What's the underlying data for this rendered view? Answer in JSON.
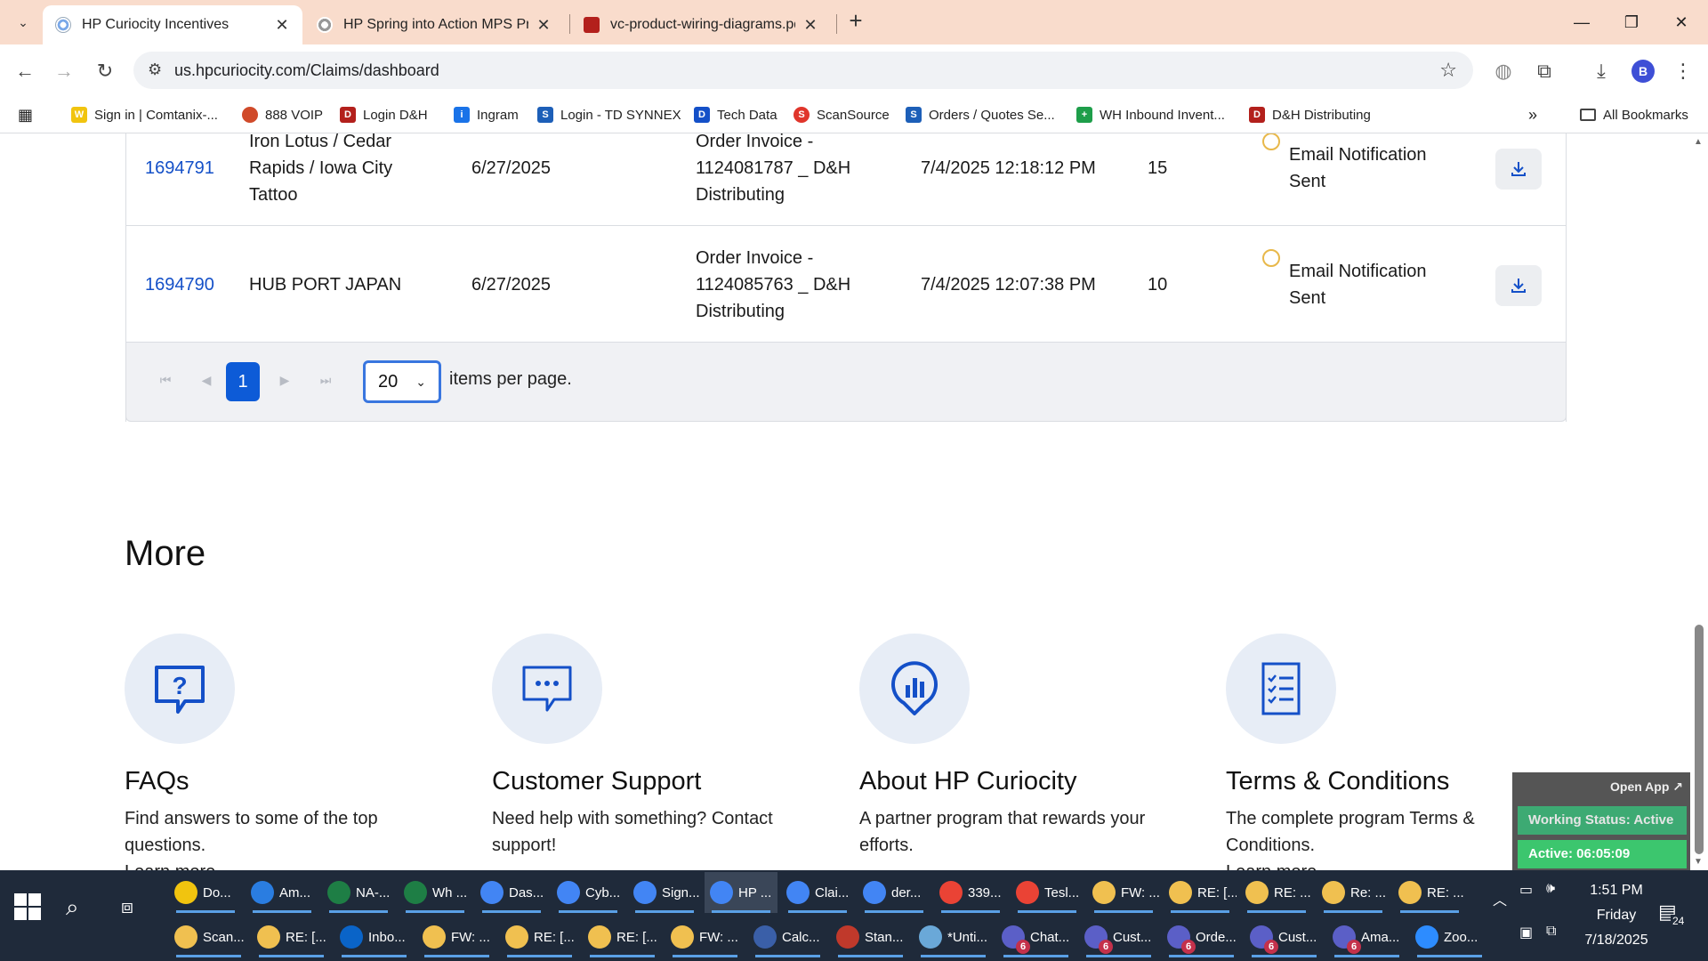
{
  "browser": {
    "tabs": [
      {
        "title": "HP Curiocity Incentives",
        "active": true
      },
      {
        "title": "HP Spring into Action MPS Pro",
        "active": false
      },
      {
        "title": "vc-product-wiring-diagrams.pd",
        "active": false
      }
    ],
    "url": "us.hpcuriocity.com/Claims/dashboard",
    "profile_initial": "B",
    "bookmarks": [
      "Sign in | Comtanix-...",
      "888 VOIP",
      "Login D&H",
      "Ingram",
      "Login - TD SYNNEX",
      "Tech Data",
      "ScanSource",
      "Orders / Quotes Se...",
      "WH Inbound Invent...",
      "D&H Distributing"
    ],
    "all_bookmarks": "All Bookmarks"
  },
  "claims": {
    "rows": [
      {
        "claim_id": "1694791",
        "customer_lines": [
          "Iron Lotus / Cedar",
          "Rapids / Iowa City",
          "Tattoo"
        ],
        "date": "6/27/2025",
        "document_lines": [
          "Order Invoice -",
          "1124081787 _ D&H",
          "Distributing"
        ],
        "submitted": "7/4/2025 12:18:12 PM",
        "quantity": "15",
        "status_lines": [
          "Email Notification",
          "Sent"
        ]
      },
      {
        "claim_id": "1694790",
        "customer_lines": [
          "HUB PORT JAPAN"
        ],
        "date": "6/27/2025",
        "document_lines": [
          "Order Invoice -",
          "1124085763 _ D&H",
          "Distributing"
        ],
        "submitted": "7/4/2025 12:07:38 PM",
        "quantity": "10",
        "status_lines": [
          "Email Notification",
          "Sent"
        ]
      }
    ],
    "pager": {
      "current_page": "1",
      "page_size": "20",
      "label": "items per page."
    }
  },
  "more": {
    "title": "More",
    "cards": [
      {
        "title": "FAQs",
        "desc_lines": [
          "Find answers to some of the top questions."
        ],
        "link": "Learn more",
        "icon": "question-bubble-icon"
      },
      {
        "title": "Customer Support",
        "desc_lines": [
          "Need help with something? Contact",
          "support!"
        ],
        "link": "",
        "icon": "chat-bubble-icon"
      },
      {
        "title": "About HP Curiocity",
        "desc_lines": [
          "A partner program that rewards your",
          "efforts."
        ],
        "link": "",
        "icon": "chart-pin-icon"
      },
      {
        "title": "Terms & Conditions",
        "desc_lines": [
          "The complete program Terms & Conditions."
        ],
        "link": "Learn more",
        "icon": "checklist-icon"
      }
    ]
  },
  "widget": {
    "open_app": "Open App ↗",
    "working_status": "Working Status: Active",
    "active_time": "Active: 06:05:09"
  },
  "taskbar": {
    "row1": [
      "Do...",
      "Am...",
      "NA-...",
      "Wh ...",
      "Das...",
      "Cyb...",
      "Sign...",
      "HP ...",
      "Clai...",
      "der...",
      "339...",
      "Tesl...",
      "FW: ...",
      "RE: [...",
      "RE: ...",
      "Re: ...",
      "RE: ..."
    ],
    "row2": [
      "Scan...",
      "RE: [...",
      "Inbo...",
      "FW: ...",
      "RE: [...",
      "RE: [...",
      "FW: ...",
      "Calc...",
      "Stan...",
      "*Unti...",
      "Chat...",
      "Cust...",
      "Orde...",
      "Cust...",
      "Ama...",
      "Zoo..."
    ],
    "badge": "6",
    "clock_time": "1:51 PM",
    "clock_day": "Friday",
    "clock_date": "7/18/2025",
    "notification_count": "24"
  },
  "colors": {
    "tabstrip": "#f9dccc",
    "link_blue": "#1450c8",
    "pager_active": "#0d5bd7",
    "status_ring": "#e8b84a",
    "taskbar": "#1f2a3a"
  }
}
